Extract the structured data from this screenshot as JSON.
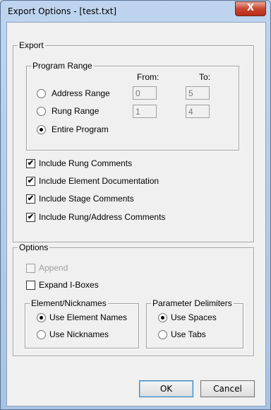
{
  "window": {
    "title": "Export Options - [test.txt]",
    "close_glyph": "X"
  },
  "export_group": {
    "label": "Export"
  },
  "program_range": {
    "label": "Program Range",
    "from_label": "From:",
    "to_label": "To:",
    "options": [
      {
        "label": "Address Range",
        "checked": false,
        "from": "0",
        "to": "5"
      },
      {
        "label": "Rung Range",
        "checked": false,
        "from": "1",
        "to": "4"
      },
      {
        "label": "Entire Program",
        "checked": true
      }
    ]
  },
  "export_checks": [
    {
      "label": "Include Rung Comments",
      "checked": true
    },
    {
      "label": "Include Element Documentation",
      "checked": true
    },
    {
      "label": "Include Stage Comments",
      "checked": true
    },
    {
      "label": "Include Rung/Address Comments",
      "checked": true
    }
  ],
  "options_group": {
    "label": "Options",
    "append": {
      "label": "Append",
      "checked": false,
      "disabled": true
    },
    "expand": {
      "label": "Expand I-Boxes",
      "checked": false
    }
  },
  "element_nicknames": {
    "label": "Element/Nicknames",
    "options": [
      {
        "label": "Use Element Names",
        "checked": true
      },
      {
        "label": "Use Nicknames",
        "checked": false
      }
    ]
  },
  "parameter_delimiters": {
    "label": "Parameter Delimiters",
    "options": [
      {
        "label": "Use Spaces",
        "checked": true
      },
      {
        "label": "Use Tabs",
        "checked": false
      }
    ]
  },
  "buttons": {
    "ok": "OK",
    "cancel": "Cancel"
  },
  "check_glyph": "✔"
}
